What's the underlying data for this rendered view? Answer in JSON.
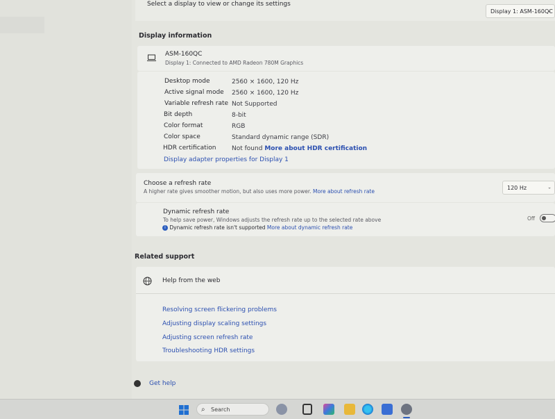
{
  "header": {
    "prompt": "Select a display to view or change its settings",
    "display_select": "Display 1: ASM-160QC"
  },
  "display_info": {
    "section_title": "Display information",
    "monitor_name": "ASM-160QC",
    "monitor_sub": "Display 1: Connected to AMD Radeon 780M Graphics",
    "rows": [
      {
        "label": "Desktop mode",
        "value": "2560 × 1600, 120 Hz"
      },
      {
        "label": "Active signal mode",
        "value": "2560 × 1600, 120 Hz"
      },
      {
        "label": "Variable refresh rate",
        "value": "Not Supported"
      },
      {
        "label": "Bit depth",
        "value": "8-bit"
      },
      {
        "label": "Color format",
        "value": "RGB"
      },
      {
        "label": "Color space",
        "value": "Standard dynamic range (SDR)"
      },
      {
        "label": "HDR certification",
        "value": "Not found",
        "link": "More about HDR certification"
      }
    ],
    "adapter_link": "Display adapter properties for Display 1"
  },
  "refresh": {
    "title": "Choose a refresh rate",
    "desc": "A higher rate gives smoother motion, but also uses more power.",
    "desc_link": "More about refresh rate",
    "selected": "120 Hz"
  },
  "dynamic": {
    "title": "Dynamic refresh rate",
    "desc": "To help save power, Windows adjusts the refresh rate up to the selected rate above",
    "notice": "Dynamic refresh rate isn't supported",
    "notice_link": "More about dynamic refresh rate",
    "toggle_label": "Off",
    "toggle_on": false
  },
  "support": {
    "section_title": "Related support",
    "card_title": "Help from the web",
    "links": [
      "Resolving screen flickering problems",
      "Adjusting display scaling settings",
      "Adjusting screen refresh rate",
      "Troubleshooting HDR settings"
    ]
  },
  "footer": {
    "get_help": "Get help"
  },
  "taskbar": {
    "search_placeholder": "Search"
  }
}
